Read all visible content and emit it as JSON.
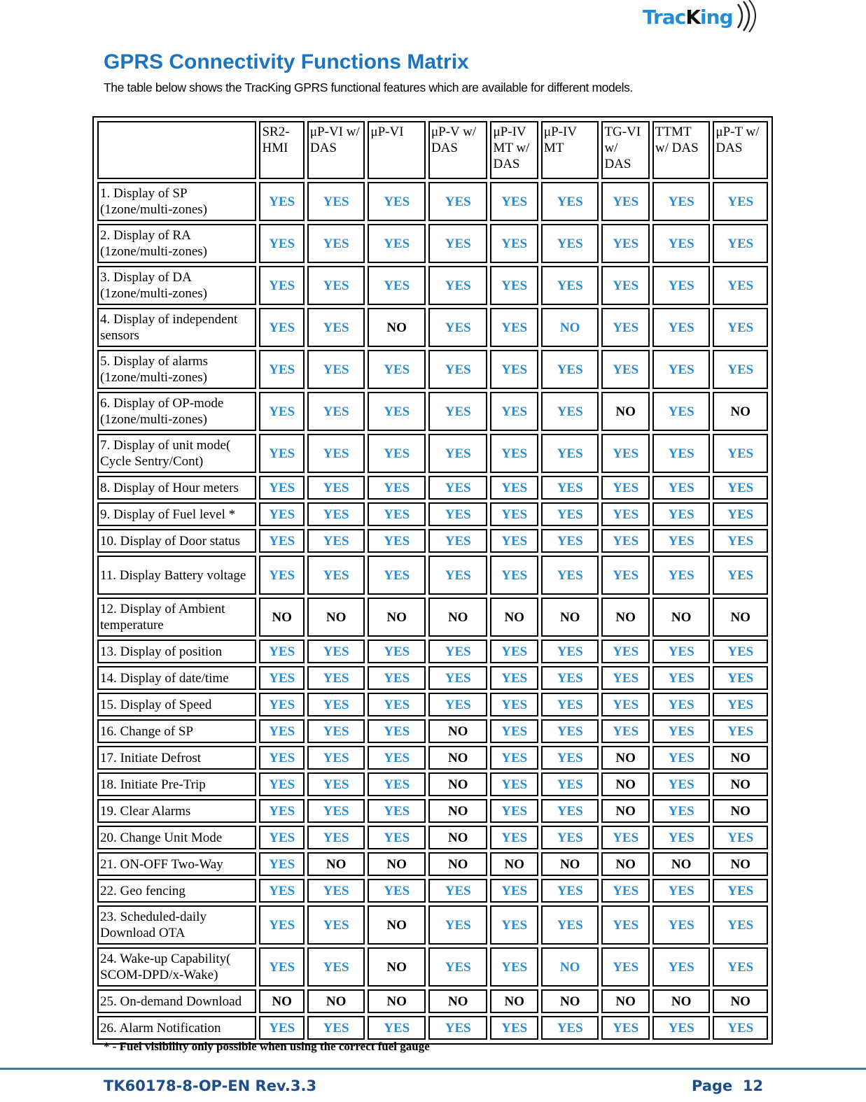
{
  "logo": {
    "part1": "Trac",
    "part2": "K",
    "part3": "ing"
  },
  "title": "GPRS Connectivity Functions Matrix",
  "intro": "The table below shows the TracKing GPRS functional features which are available for different models.",
  "colors": {
    "title": "#1a74c0",
    "yes": "#2a8bd0",
    "no": "#000000",
    "footer": "#1f4e87",
    "rule": "#3a7f9a"
  },
  "matrix": {
    "columns": [
      "SR2-HMI",
      "μP-VI w/ DAS",
      "μP-VI",
      "μP-V w/ DAS",
      "μP-IV MT w/ DAS",
      "μP-IV MT",
      "TG-VI w/ DAS",
      "TTMT w/ DAS",
      "μP-T w/ DAS"
    ],
    "rows": [
      {
        "label": "1. Display of SP (1zone/multi-zones)",
        "values": [
          "YES",
          "YES",
          "YES",
          "YES",
          "YES",
          "YES",
          "YES",
          "YES",
          "YES"
        ]
      },
      {
        "label": "2.  Display of RA (1zone/multi-zones)",
        "values": [
          "YES",
          "YES",
          "YES",
          "YES",
          "YES",
          "YES",
          "YES",
          "YES",
          "YES"
        ]
      },
      {
        "label": "3.  Display of DA (1zone/multi-zones)",
        "values": [
          "YES",
          "YES",
          "YES",
          "YES",
          "YES",
          "YES",
          "YES",
          "YES",
          "YES"
        ]
      },
      {
        "label": "4.  Display of independent sensors",
        "values": [
          "YES",
          "YES",
          "NO",
          "YES",
          "YES",
          "NO",
          "YES",
          "YES",
          "YES"
        ],
        "blue_no": [
          5
        ]
      },
      {
        "label": "5.  Display of alarms (1zone/multi-zones)",
        "values": [
          "YES",
          "YES",
          "YES",
          "YES",
          "YES",
          "YES",
          "YES",
          "YES",
          "YES"
        ]
      },
      {
        "label": "6.  Display of OP-mode (1zone/multi-zones)",
        "values": [
          "YES",
          "YES",
          "YES",
          "YES",
          "YES",
          "YES",
          "NO",
          "YES",
          "NO"
        ]
      },
      {
        "label": "7.  Display of unit mode( Cycle Sentry/Cont)",
        "values": [
          "YES",
          "YES",
          "YES",
          "YES",
          "YES",
          "YES",
          "YES",
          "YES",
          "YES"
        ]
      },
      {
        "label": "8.  Display of Hour meters",
        "values": [
          "YES",
          "YES",
          "YES",
          "YES",
          "YES",
          "YES",
          "YES",
          "YES",
          "YES"
        ]
      },
      {
        "label": "9.  Display of Fuel level *",
        "values": [
          "YES",
          "YES",
          "YES",
          "YES",
          "YES",
          "YES",
          "YES",
          "YES",
          "YES"
        ]
      },
      {
        "label": "10. Display of Door status",
        "values": [
          "YES",
          "YES",
          "YES",
          "YES",
          "YES",
          "YES",
          "YES",
          "YES",
          "YES"
        ]
      },
      {
        "label": "11. Display Battery voltage",
        "values": [
          "YES",
          "YES",
          "YES",
          "YES",
          "YES",
          "YES",
          "YES",
          "YES",
          "YES"
        ]
      },
      {
        "label": "12. Display of Ambient temperature",
        "values": [
          "NO",
          "NO",
          "NO",
          "NO",
          "NO",
          "NO",
          "NO",
          "NO",
          "NO"
        ]
      },
      {
        "label": "13. Display of position",
        "values": [
          "YES",
          "YES",
          "YES",
          "YES",
          "YES",
          "YES",
          "YES",
          "YES",
          "YES"
        ]
      },
      {
        "label": "14. Display of date/time",
        "values": [
          "YES",
          "YES",
          "YES",
          "YES",
          "YES",
          "YES",
          "YES",
          "YES",
          "YES"
        ]
      },
      {
        "label": "15. Display of Speed",
        "values": [
          "YES",
          "YES",
          "YES",
          "YES",
          "YES",
          "YES",
          "YES",
          "YES",
          "YES"
        ]
      },
      {
        "label": "16. Change of SP",
        "values": [
          "YES",
          "YES",
          "YES",
          "NO",
          "YES",
          "YES",
          "YES",
          "YES",
          "YES"
        ]
      },
      {
        "label": "17. Initiate  Defrost",
        "values": [
          "YES",
          "YES",
          "YES",
          "NO",
          "YES",
          "YES",
          "NO",
          "YES",
          "NO"
        ]
      },
      {
        "label": "18. Initiate Pre-Trip",
        "values": [
          "YES",
          "YES",
          "YES",
          "NO",
          "YES",
          "YES",
          "NO",
          "YES",
          "NO"
        ]
      },
      {
        "label": "19. Clear Alarms",
        "values": [
          "YES",
          "YES",
          "YES",
          "NO",
          "YES",
          "YES",
          "NO",
          "YES",
          "NO"
        ]
      },
      {
        "label": "20. Change Unit Mode",
        "values": [
          "YES",
          "YES",
          "YES",
          "NO",
          "YES",
          "YES",
          "YES",
          "YES",
          "YES"
        ]
      },
      {
        "label": "21. ON-OFF Two-Way",
        "values": [
          "YES",
          "NO",
          "NO",
          "NO",
          "NO",
          "NO",
          "NO",
          "NO",
          "NO"
        ]
      },
      {
        "label": "22. Geo fencing",
        "values": [
          "YES",
          "YES",
          "YES",
          "YES",
          "YES",
          "YES",
          "YES",
          "YES",
          "YES"
        ]
      },
      {
        "label": "23. Scheduled-daily Download OTA",
        "values": [
          "YES",
          "YES",
          "NO",
          "YES",
          "YES",
          "YES",
          "YES",
          "YES",
          "YES"
        ]
      },
      {
        "label": "24. Wake-up Capability( SCOM-DPD/x-Wake)",
        "values": [
          "YES",
          "YES",
          "NO",
          "YES",
          "YES",
          "NO",
          "YES",
          "YES",
          "YES"
        ],
        "blue_no": [
          5
        ]
      },
      {
        "label": "25. On-demand Download",
        "values": [
          "NO",
          "NO",
          "NO",
          "NO",
          "NO",
          "NO",
          "NO",
          "NO",
          "NO"
        ]
      },
      {
        "label": "26. Alarm Notification",
        "values": [
          "YES",
          "YES",
          "YES",
          "YES",
          "YES",
          "YES",
          "YES",
          "YES",
          "YES"
        ]
      }
    ]
  },
  "footnote": "* - Fuel visibility only possible when using the correct fuel gauge",
  "footer": {
    "doc_id": "TK60178-8-OP-EN Rev.3.3",
    "page": "Page  12"
  }
}
